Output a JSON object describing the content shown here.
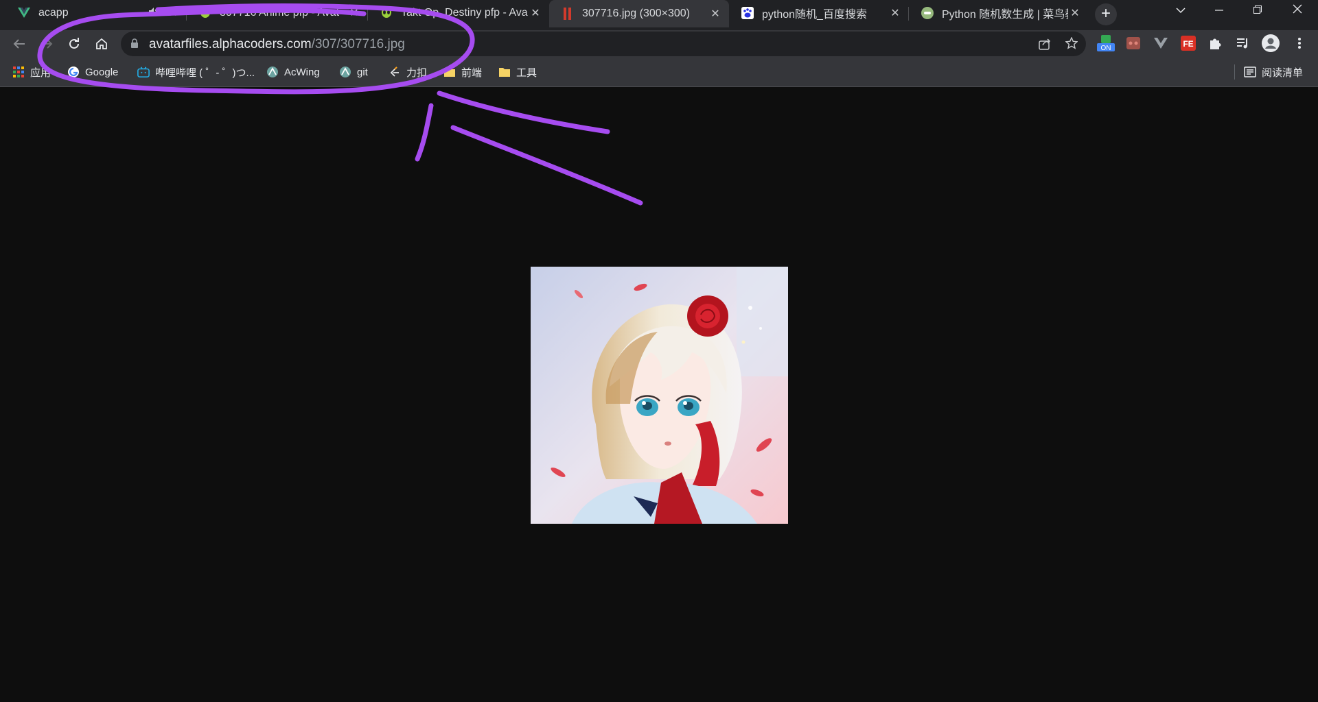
{
  "tabs": [
    {
      "title": "acapp",
      "icon": "vue-icon",
      "active": false,
      "muted": true
    },
    {
      "title": "307716 Anime pfp - Avat",
      "icon": "alien-icon",
      "active": false
    },
    {
      "title": "Takt Op. Destiny pfp - Ava",
      "icon": "alien-icon",
      "active": false
    },
    {
      "title": "307716.jpg (300×300)",
      "icon": "image-icon",
      "active": true
    },
    {
      "title": "python随机_百度搜索",
      "icon": "baidu-icon",
      "active": false
    },
    {
      "title": "Python 随机数生成 | 菜鸟教程",
      "icon": "runoob-icon",
      "active": false
    }
  ],
  "address": {
    "host": "avatarfiles.alphacoders.com",
    "path": "/307/307716.jpg"
  },
  "extensions": {
    "on_badge": "ON",
    "fe_badge": "FE"
  },
  "bookmarks": [
    {
      "label": "应用",
      "icon": "apps-grid-icon"
    },
    {
      "label": "Google",
      "icon": "google-icon"
    },
    {
      "label": "哔哩哔哩 ( ゜- ゜)つ...",
      "icon": "bilibili-icon"
    },
    {
      "label": "AcWing",
      "icon": "acwing-icon"
    },
    {
      "label": "git",
      "icon": "acwing-icon"
    },
    {
      "label": "力扣",
      "icon": "leetcode-icon"
    },
    {
      "label": "前端",
      "icon": "folder-icon"
    },
    {
      "label": "工具",
      "icon": "folder-icon"
    }
  ],
  "reading_list": "阅读清单",
  "colors": {
    "annotation": "#a64cf0",
    "page_bg": "#0e0e0e",
    "toolbar_bg": "#35363a"
  }
}
